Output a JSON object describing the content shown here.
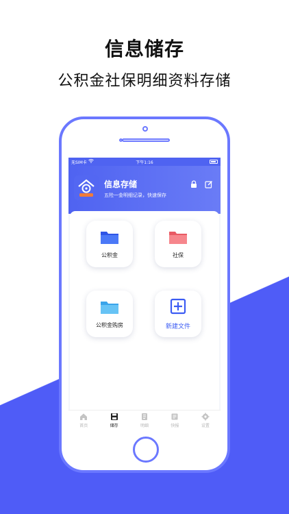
{
  "promo": {
    "title": "信息储存",
    "subtitle": "公积金社保明细资料存储"
  },
  "status_bar": {
    "carrier": "无SIM卡",
    "time": "下午1:16"
  },
  "header": {
    "app_title": "信息存储",
    "tagline": "五险一金明细记录，快速保存"
  },
  "tiles": [
    {
      "label": "公积金",
      "icon": "folder-blue-icon",
      "color": "#3f67f3"
    },
    {
      "label": "社保",
      "icon": "folder-pink-icon",
      "color": "#f2737b"
    },
    {
      "label": "公积金购房",
      "icon": "folder-lightblue-icon",
      "color": "#56b8f2"
    },
    {
      "label": "新建文件",
      "icon": "plus-square-icon",
      "color": "#3b5bf3"
    }
  ],
  "tabs": [
    {
      "label": "首页",
      "icon": "home-icon",
      "active": false
    },
    {
      "label": "储存",
      "icon": "save-icon",
      "active": true
    },
    {
      "label": "明细",
      "icon": "notebook-icon",
      "active": false
    },
    {
      "label": "快报",
      "icon": "document-icon",
      "active": false
    },
    {
      "label": "设置",
      "icon": "gear-icon",
      "active": false
    }
  ],
  "colors": {
    "accent": "#4f5cf7",
    "header": "#4f63f1"
  }
}
